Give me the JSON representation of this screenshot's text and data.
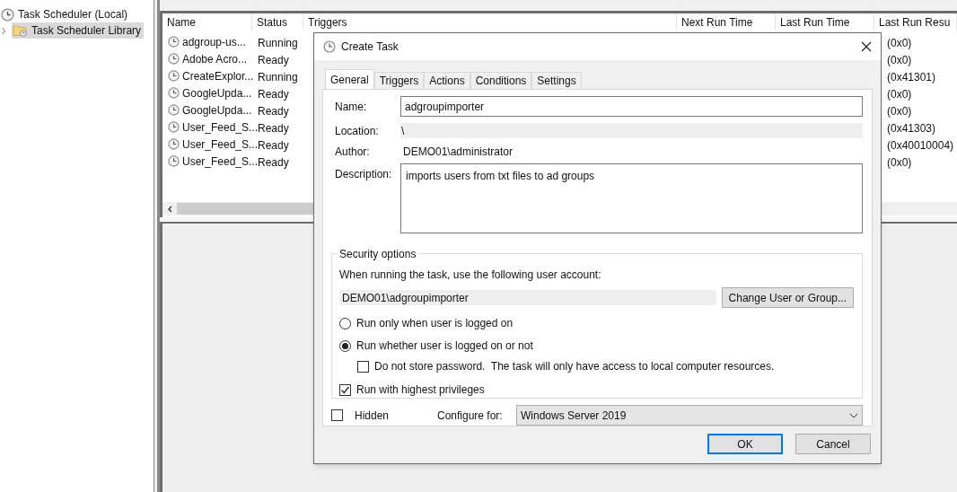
{
  "tree": {
    "items": [
      {
        "label": "Task Scheduler (Local)",
        "selected": false,
        "children": [
          {
            "label": "Task Scheduler Library",
            "selected": true,
            "expanded": false
          }
        ]
      }
    ]
  },
  "table": {
    "columns": [
      "Name",
      "Status",
      "Triggers",
      "Next Run Time",
      "Last Run Time",
      "Last Run Resu"
    ],
    "rows": [
      {
        "name": "adgroup-us...",
        "status": "Running",
        "result": "(0x0)"
      },
      {
        "name": "Adobe Acro...",
        "status": "Ready",
        "result": "(0x0)"
      },
      {
        "name": "CreateExplor...",
        "status": "Running",
        "result": "(0x41301)"
      },
      {
        "name": "GoogleUpda...",
        "status": "Ready",
        "result": "(0x0)"
      },
      {
        "name": "GoogleUpda...",
        "status": "Ready",
        "result": "(0x0)"
      },
      {
        "name": "User_Feed_S...",
        "status": "Ready",
        "result": "(0x41303)"
      },
      {
        "name": "User_Feed_S...",
        "status": "Ready",
        "result": "(0x40010004)"
      },
      {
        "name": "User_Feed_S...",
        "status": "Ready",
        "result": "(0x0)"
      }
    ]
  },
  "dialog": {
    "title": "Create Task",
    "tabs": [
      {
        "label": "General",
        "selected": true
      },
      {
        "label": "Triggers",
        "selected": false
      },
      {
        "label": "Actions",
        "selected": false
      },
      {
        "label": "Conditions",
        "selected": false
      },
      {
        "label": "Settings",
        "selected": false
      }
    ],
    "name_label": "Name:",
    "name_value": "adgroupimporter",
    "location_label": "Location:",
    "location_value": "\\",
    "author_label": "Author:",
    "author_value": "DEMO01\\administrator",
    "description_label": "Description:",
    "description_value": "imports users from txt files to ad groups",
    "security": {
      "legend": "Security options",
      "prompt": "When running the task, use the following user account:",
      "account": "DEMO01\\adgroupimporter",
      "change_button": "Change User or Group...",
      "radios": [
        {
          "label": "Run only when user is logged on",
          "selected": false
        },
        {
          "label": "Run whether user is logged on or not",
          "selected": true
        }
      ],
      "no_password": {
        "label": "Do not store password.  The task will only have access to local computer resources.",
        "checked": false
      },
      "highest": {
        "label": "Run with highest privileges",
        "checked": true
      }
    },
    "hidden": {
      "label": "Hidden",
      "checked": false
    },
    "configure_label": "Configure for:",
    "configure_value": "Windows Server 2019",
    "buttons": [
      {
        "label": "OK",
        "kind": "default"
      },
      {
        "label": "Cancel",
        "kind": "normal"
      }
    ]
  }
}
